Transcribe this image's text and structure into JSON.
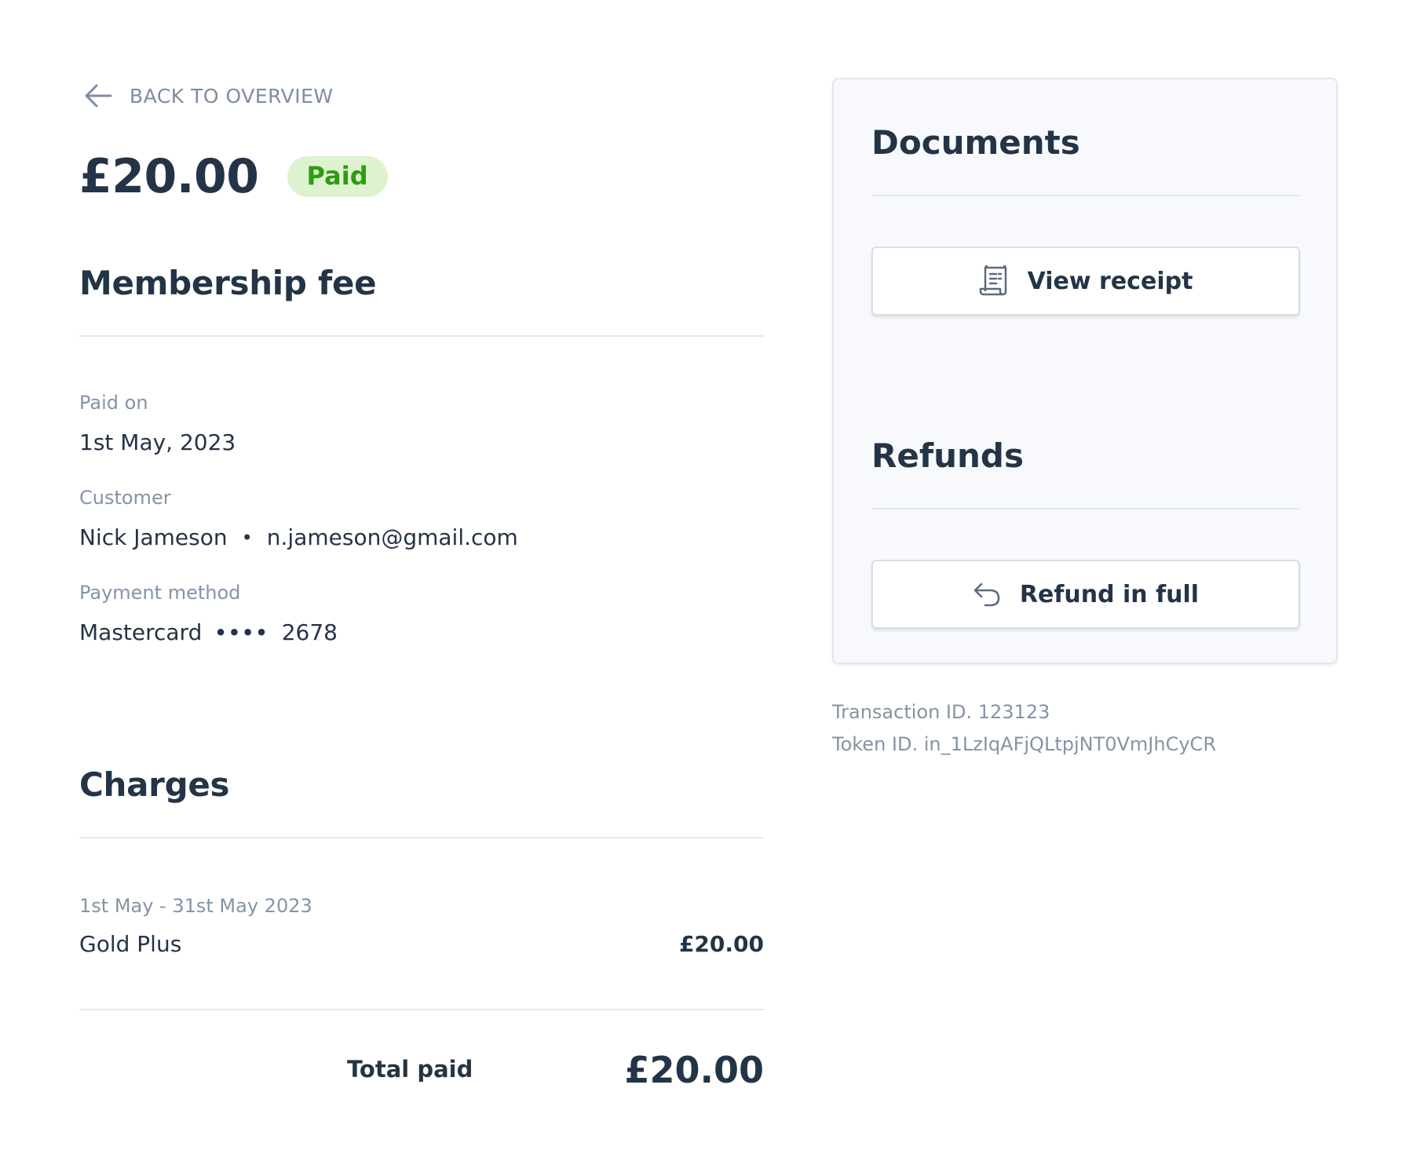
{
  "navigation": {
    "back_label": "BACK TO OVERVIEW"
  },
  "summary": {
    "amount": "£20.00",
    "status": "Paid"
  },
  "details": {
    "title": "Membership fee",
    "paid_on_label": "Paid on",
    "paid_on_value": "1st May, 2023",
    "customer_label": "Customer",
    "customer_name": "Nick Jameson",
    "customer_separator": "•",
    "customer_email": "n.jameson@gmail.com",
    "payment_method_label": "Payment method",
    "card_brand": "Mastercard",
    "card_dots": "••••",
    "card_last4": "2678"
  },
  "charges": {
    "title": "Charges",
    "items": [
      {
        "period": "1st May - 31st May 2023",
        "name": "Gold Plus",
        "amount": "£20.00"
      }
    ],
    "total_label": "Total paid",
    "total_amount": "£20.00"
  },
  "documents": {
    "title": "Documents",
    "view_receipt_label": "View receipt",
    "icon": "receipt-icon"
  },
  "refunds": {
    "title": "Refunds",
    "refund_full_label": "Refund in full",
    "icon": "undo-icon"
  },
  "meta": {
    "transaction_id": "Transaction ID. 123123",
    "token_id": "Token ID. in_1LzIqAFjQLtpjNT0VmJhCyCR"
  },
  "colors": {
    "text": "#243447",
    "muted": "#8593a6",
    "paid_badge_bg": "#ddf3cf",
    "paid_badge_text": "#2f9b14",
    "panel_bg": "#f7f9fc"
  }
}
